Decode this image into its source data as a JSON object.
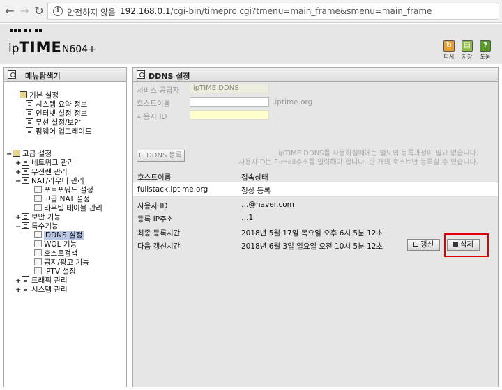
{
  "browser": {
    "security_label": "안전하지 않음",
    "url_host": "192.168.0.1",
    "url_path": "/cgi-bin/timepro.cgi?tmenu=main_frame&smenu=main_frame"
  },
  "header": {
    "logo_ip": "ip",
    "logo_time": "TIME",
    "logo_model": "N604+",
    "buttons": [
      {
        "label": "다시",
        "icon": "restart-icon"
      },
      {
        "label": "저장",
        "icon": "save-icon"
      },
      {
        "label": "도움",
        "icon": "help-icon"
      }
    ]
  },
  "sidebar": {
    "title": "메뉴탐색기",
    "basic": {
      "label": "기본 설정",
      "items": [
        "시스템 요약 정보",
        "인터넷 설정 정보",
        "무선 설정/보안",
        "펌웨어 업그레이드"
      ]
    },
    "advanced": {
      "label": "고급 설정",
      "network": "네트워크 관리",
      "wireless": "무선랜 관리",
      "nat": "NAT/라우터 관리",
      "nat_items": [
        "포트포워드 설정",
        "고급 NAT 설정",
        "라우팅 테이블 관리"
      ],
      "security": "보안 기능",
      "special": "특수기능",
      "special_items": [
        "DDNS 설정",
        "WOL 기능",
        "호스트검색",
        "공지/광고 기능",
        "IPTV 설정"
      ],
      "traffic": "트래픽 관리",
      "system": "시스템 관리"
    }
  },
  "main": {
    "title": "DDNS 설정",
    "form": {
      "provider_label": "서비스 공급자",
      "provider_value": "ipTIME DDNS",
      "hostname_label": "호스트이름",
      "hostname_value": "",
      "hostname_suffix": ".iptime.org",
      "userid_label": "사용자 ID",
      "userid_value": ""
    },
    "register_button": "DDNS 등록",
    "notice_line1": "ipTIME DDNS를 사용하실때에는 별도의 등록과정이 필요 없습니다.",
    "notice_line2": "사용자ID는 E-mail주소를 입력해야 합니다. 한 개의 호스트만 등록할 수 있습니다.",
    "table": {
      "col_host": "호스트이름",
      "col_status": "접속상태",
      "host": "fullstack.iptime.org",
      "status": "정상 등록"
    },
    "details": [
      {
        "label": "사용자 ID",
        "value": "…@naver.com"
      },
      {
        "label": "등록 IP주소",
        "value": "…1"
      },
      {
        "label": "최종 등록시간",
        "value": "2018년 5월 17일 목요일 오후 6시 5분 12초"
      },
      {
        "label": "다음 갱신시간",
        "value": "2018년 6월 3일 일요일 오전 10시 5분 12초"
      }
    ],
    "refresh_button": "갱신",
    "delete_button": "삭제"
  }
}
